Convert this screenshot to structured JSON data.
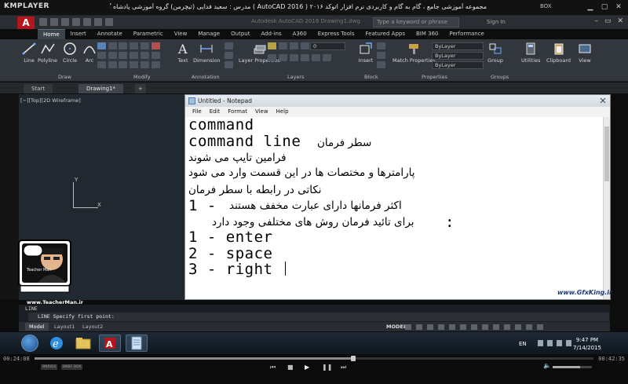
{
  "player": {
    "logo": "KMPLAYER",
    "title": "مجموعه آموزشی جامع ، گام به گام و کاربردی نرم افزار  اتوکد ۲۰۱۶ ( AutoCAD 2016 )  مدرس : سعید فدایی (تیچرمن) گروه آموزشی پادشاه گرافیست ها",
    "box_label": "BOX",
    "time_elapsed": "00:24:08",
    "time_total": "00:42:35",
    "progress": 0.57,
    "volume": 0.7,
    "controls": [
      "prev",
      "stop",
      "play",
      "pause",
      "next"
    ],
    "badges": [
      "BNRIOS",
      "BNBC BOX"
    ]
  },
  "autocad": {
    "app_letter": "A",
    "doc_name": "Autodesk AutoCAD 2016  Drawing1.dwg",
    "search_placeholder": "Type a keyword or phrase",
    "sign_in": "Sign In",
    "ribbon_tabs": [
      "Home",
      "Insert",
      "Annotate",
      "Parametric",
      "View",
      "Manage",
      "Output",
      "Add-ins",
      "A360",
      "Express Tools",
      "Featured Apps",
      "BIM 360",
      "Performance"
    ],
    "active_tab": "Home",
    "tools": {
      "line": "Line",
      "polyline": "Polyline",
      "circle": "Circle",
      "arc": "Arc",
      "text": "Text",
      "dimension": "Dimension",
      "layer_properties": "Layer Properties",
      "insert": "Insert",
      "match_properties": "Match Properties",
      "group": "Group",
      "utilities": "Utilities",
      "clipboard": "Clipboard",
      "view": "View"
    },
    "bylayer": [
      "ByLayer",
      "ByLayer",
      "ByLayer"
    ],
    "layer_value": "0",
    "panels": [
      "Draw",
      "Modify",
      "Annotation",
      "Layers",
      "Block",
      "Properties",
      "Groups"
    ],
    "file_tabs": [
      "Start",
      "Drawing1*"
    ],
    "active_file_tab": "Drawing1*",
    "view_label": "[−][Top][2D Wireframe]",
    "axis": {
      "x": "X",
      "y": "Y"
    },
    "command_history": "LINE",
    "command_prompt": "LINE Specify first point:",
    "layout_tabs": [
      "Model",
      "Layout1",
      "Layout2"
    ],
    "active_layout": "Model",
    "status_model": "MODEL"
  },
  "notepad": {
    "title": "Untitled - Notepad",
    "menu": [
      "File",
      "Edit",
      "Format",
      "View",
      "Help"
    ],
    "lines": {
      "l1": "command",
      "l2a": "command line",
      "l2b": "سطر فرمان",
      "l3": "فرامین تایپ می شوند",
      "l4": "پارامترها و مختصات ها در این قسمت وارد می شود",
      "l5": "نکاتی در رابطه با سطر فرمان",
      "l6a": "1 -",
      "l6b": "اکثر فرمانها دارای عبارت مخفف هستند",
      "l7a": ":",
      "l7b": "برای تائید فرمان روش های مختلفی وجود دارد",
      "l8": "1 - enter",
      "l9": "2 - space",
      "l10": "3 - right"
    }
  },
  "watermark": "www.GfxKing.ir",
  "teacher": {
    "url": "www.TeacherMan.ir",
    "name": "Teacher Man"
  },
  "taskbar": {
    "lang": "EN",
    "time": "9:47 PM",
    "date": "7/14/2015"
  },
  "colors": {
    "autocad_red": "#b5161b",
    "ribbon": "#32373d",
    "drawing_bg": "#212830"
  }
}
